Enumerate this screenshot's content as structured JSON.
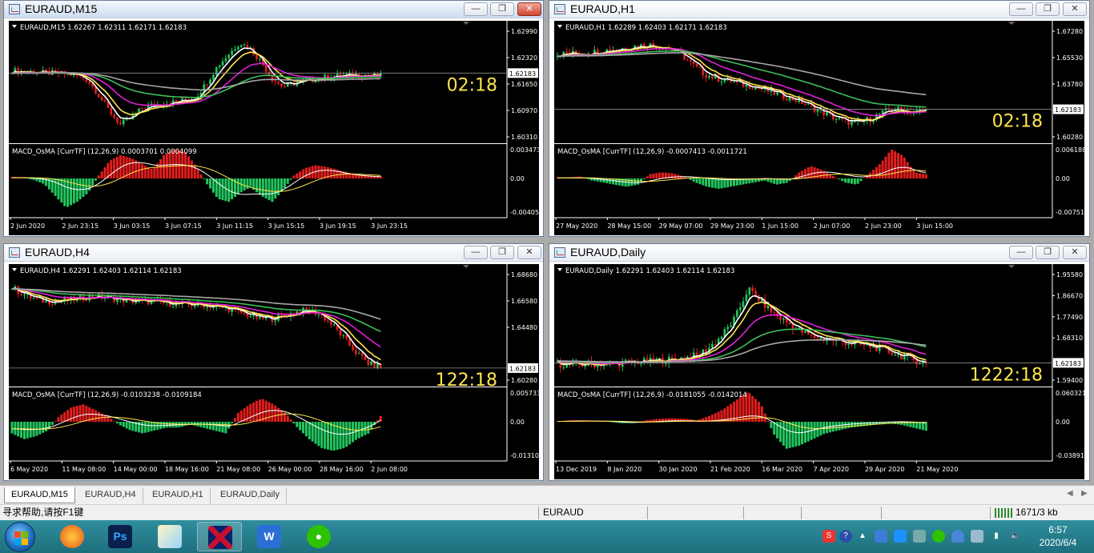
{
  "windows": [
    {
      "id": "m15",
      "title": "EURAUD,M15",
      "active": true,
      "header": "EURAUD,M15  1.62267 1.62311 1.62171 1.62183",
      "price_levels": [
        "1.62990",
        "1.62320",
        "1.61650",
        "1.60970",
        "1.60310"
      ],
      "current_price": "1.62183",
      "countdown": "02:18",
      "indicator_header": "MACD_OsMA [CurrTF] (12,26,9) 0.0003701 0.0004099",
      "indicator_levels": [
        "0.0034736",
        "0.00",
        "-0.0040537"
      ],
      "time_labels": [
        "2 Jun 2020",
        "2 Jun 23:15",
        "3 Jun 03:15",
        "3 Jun 07:15",
        "3 Jun 11:15",
        "3 Jun 15:15",
        "3 Jun 19:15",
        "3 Jun 23:15"
      ],
      "series": [
        0.45,
        0.42,
        0.4,
        0.38,
        0.36,
        0.34,
        0.3,
        0.15,
        -0.3,
        -0.8,
        -1.2,
        -1.0,
        -0.7,
        -0.6,
        -0.55,
        -0.5,
        -0.45,
        -0.35,
        0.1,
        0.6,
        0.95,
        1.3,
        1.1,
        0.7,
        0.2,
        -0.05,
        0.05,
        0.12,
        0.2,
        0.25,
        0.28,
        0.3,
        0.32,
        0.3,
        0.28
      ],
      "macd_hist": [
        0.05,
        0.02,
        -0.05,
        -0.2,
        -0.6,
        -1.0,
        -0.8,
        -0.5,
        0.1,
        0.6,
        0.8,
        0.7,
        0.5,
        0.3,
        0.8,
        1.0,
        0.9,
        0.4,
        -0.2,
        -0.7,
        -0.8,
        -0.5,
        -0.3,
        -0.6,
        -0.8,
        -0.4,
        0.1,
        0.35,
        0.45,
        0.4,
        0.3,
        0.2,
        0.15,
        0.1,
        0.08
      ]
    },
    {
      "id": "h1",
      "title": "EURAUD,H1",
      "active": false,
      "header": "EURAUD,H1  1.62289 1.62403 1.62171 1.62183",
      "price_levels": [
        "1.67280",
        "1.65530",
        "1.63780",
        "1.62183",
        "1.60280"
      ],
      "current_price": "1.62183",
      "countdown": "02:18",
      "indicator_header": "MACD_OsMA [CurrTF] (12,26,9) -0.0007413 -0.0011721",
      "indicator_levels": [
        "0.0061881",
        "0.00",
        "-0.0075127"
      ],
      "time_labels": [
        "27 May 2020",
        "28 May 15:00",
        "29 May 07:00",
        "29 May 23:00",
        "1 Jun 15:00",
        "2 Jun 07:00",
        "2 Jun 23:00",
        "3 Jun 15:00"
      ],
      "series": [
        1.25,
        1.3,
        1.28,
        1.32,
        1.38,
        1.4,
        1.45,
        1.5,
        1.52,
        1.48,
        1.4,
        1.2,
        0.9,
        0.7,
        0.6,
        0.55,
        0.45,
        0.4,
        0.3,
        0.2,
        0.1,
        0.0,
        -0.15,
        -0.3,
        -0.45,
        -0.55,
        -0.6,
        -0.5,
        -0.35,
        -0.2,
        -0.25,
        -0.3,
        -0.25
      ],
      "macd_hist": [
        0.05,
        0.05,
        0.1,
        -0.1,
        -0.2,
        -0.3,
        -0.4,
        -0.3,
        0.2,
        0.3,
        0.25,
        0.1,
        -0.2,
        -0.4,
        -0.5,
        -0.4,
        -0.3,
        -0.2,
        -0.1,
        -0.3,
        -0.2,
        0.3,
        0.6,
        0.4,
        0.1,
        -0.2,
        -0.3,
        0.2,
        0.7,
        1.4,
        1.1,
        0.3,
        0.2
      ]
    },
    {
      "id": "h4",
      "title": "EURAUD,H4",
      "active": false,
      "header": "EURAUD,H4  1.62291 1.62403 1.62114 1.62183",
      "price_levels": [
        "1.68680",
        "1.66580",
        "1.64480",
        "1.62183",
        "1.60280"
      ],
      "current_price": "1.62183",
      "countdown": "122:18",
      "indicator_header": "MACD_OsMA [CurrTF] (12,26,9) -0.0103238 -0.0109184",
      "indicator_levels": [
        "0.0057339",
        "0.00",
        "-0.013108"
      ],
      "time_labels": [
        "6 May 2020",
        "11 May 08:00",
        "14 May 00:00",
        "18 May 16:00",
        "21 May 08:00",
        "26 May 00:00",
        "28 May 16:00",
        "2 Jun 08:00"
      ],
      "series": [
        1.7,
        1.5,
        1.35,
        1.3,
        1.3,
        1.35,
        1.4,
        1.45,
        1.4,
        1.35,
        1.3,
        1.3,
        1.28,
        1.25,
        1.22,
        1.2,
        1.2,
        1.15,
        1.1,
        1.0,
        0.9,
        0.8,
        0.8,
        0.9,
        1.0,
        1.05,
        0.9,
        0.6,
        0.2,
        -0.2,
        -0.5,
        -0.6
      ],
      "macd_hist": [
        -0.4,
        -0.6,
        -0.5,
        -0.3,
        0.2,
        0.5,
        0.6,
        0.4,
        0.2,
        -0.1,
        -0.3,
        -0.4,
        -0.3,
        -0.2,
        -0.2,
        -0.1,
        -0.2,
        -0.3,
        -0.4,
        0.3,
        0.6,
        0.8,
        0.6,
        0.3,
        -0.2,
        -0.6,
        -0.9,
        -1.0,
        -0.9,
        -0.6,
        -0.4,
        0.2
      ]
    },
    {
      "id": "daily",
      "title": "EURAUD,Daily",
      "active": false,
      "header": "EURAUD,Daily  1.62291 1.62403 1.62114 1.62183",
      "price_levels": [
        "1.95580",
        "1.86670",
        "1.77490",
        "1.68310",
        "1.62183",
        "1.59400"
      ],
      "current_price": "1.62183",
      "countdown": "1222:18",
      "indicator_header": "MACD_OsMA [CurrTF] (12,26,9) -0.0181055 -0.0142014",
      "indicator_levels": [
        "0.060321",
        "0.00",
        "-0.038915"
      ],
      "time_labels": [
        "13 Dec 2019",
        "8 Jan 2020",
        "30 Jan 2020",
        "21 Feb 2020",
        "16 Mar 2020",
        "7 Apr 2020",
        "29 Apr 2020",
        "21 May 2020"
      ],
      "series": [
        -0.7,
        -0.72,
        -0.72,
        -0.7,
        -0.7,
        -0.68,
        -0.65,
        -0.65,
        -0.62,
        -0.6,
        -0.55,
        -0.5,
        -0.3,
        0.0,
        0.4,
        1.1,
        0.8,
        0.5,
        0.3,
        0.1,
        -0.05,
        -0.1,
        -0.15,
        -0.2,
        -0.25,
        -0.3,
        -0.4,
        -0.5,
        -0.6,
        -0.7
      ],
      "macd_hist": [
        0.02,
        0.05,
        0.05,
        0.03,
        0.0,
        -0.05,
        -0.05,
        0.05,
        0.1,
        0.12,
        0.1,
        0.05,
        0.2,
        0.4,
        0.7,
        1.0,
        0.6,
        -0.4,
        -0.9,
        -0.8,
        -0.6,
        -0.4,
        -0.3,
        -0.2,
        -0.15,
        -0.1,
        -0.05,
        -0.1,
        -0.2,
        -0.3
      ]
    }
  ],
  "tabs": [
    "EURAUD,M15",
    "EURAUD,H4",
    "EURAUD,H1",
    "EURAUD,Daily"
  ],
  "selected_tab": 0,
  "status": {
    "help": "寻求帮助,请按F1键",
    "profile": "EURAUD",
    "traffic": "1671/3 kb"
  },
  "taskbar": {
    "apps": [
      "start-button",
      "firefox",
      "photoshop",
      "paint",
      "uk-flag-app",
      "wps-writer",
      "wechat"
    ],
    "time": "6:57",
    "date": "2020/6/4"
  },
  "colors": {
    "chart_bg": "#000000",
    "bull": "#22c55e",
    "bear": "#e11d1d",
    "ma_white": "#ffffff",
    "ma_yellow": "#ffe44d",
    "ma_magenta": "#e020d8",
    "ma_green": "#3cbf5a",
    "ma_gray": "#a8a8a8",
    "countdown": "#ffe44d",
    "axis_text": "#ffffff"
  }
}
